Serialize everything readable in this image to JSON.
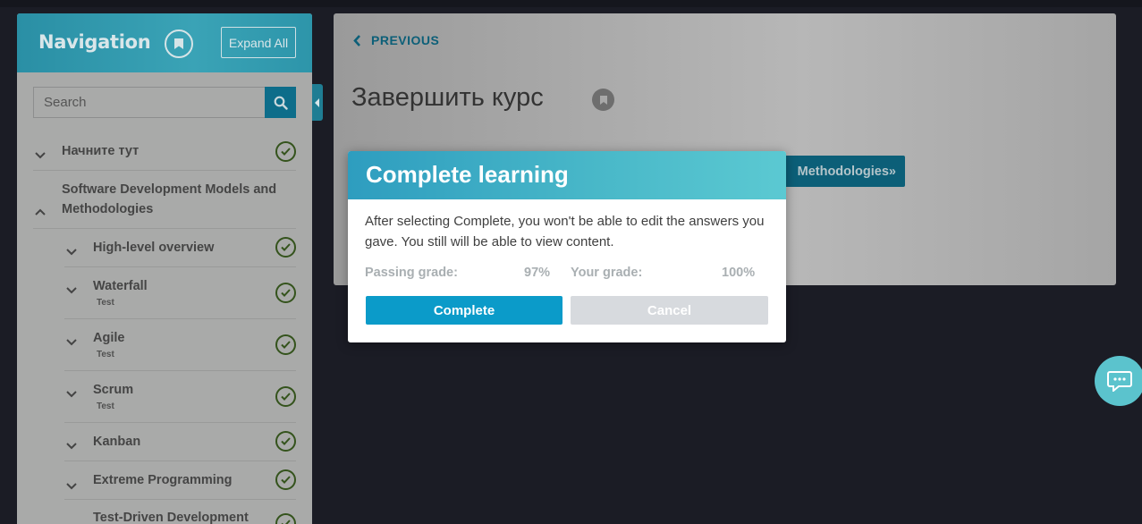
{
  "sidebar": {
    "title": "Navigation",
    "expand_all_label": "Expand All",
    "search_placeholder": "Search",
    "items": [
      {
        "label": "Начните тут",
        "sub": "",
        "level": 0,
        "expanded": false,
        "completed": true
      },
      {
        "label_line1": "Software Development Models and",
        "label_line2": "Methodologies",
        "level": 0,
        "expanded": true,
        "completed": false
      },
      {
        "label": "High-level overview",
        "sub": "",
        "level": 1,
        "expanded": false,
        "completed": true
      },
      {
        "label": "Waterfall",
        "sub": "Test",
        "level": 1,
        "expanded": false,
        "completed": true
      },
      {
        "label": "Agile",
        "sub": "Test",
        "level": 1,
        "expanded": false,
        "completed": true
      },
      {
        "label": "Scrum",
        "sub": "Test",
        "level": 1,
        "expanded": false,
        "completed": true
      },
      {
        "label": "Kanban",
        "sub": "",
        "level": 1,
        "expanded": false,
        "completed": true
      },
      {
        "label": "Extreme Programming",
        "sub": "",
        "level": 1,
        "expanded": false,
        "completed": true
      },
      {
        "label": "Test-Driven Development",
        "sub": "",
        "level": 1,
        "expanded": false,
        "completed": true
      }
    ]
  },
  "main": {
    "previous_label": "PREVIOUS",
    "page_title": "Завершить курс",
    "obscured_button_label": "Methodologies»"
  },
  "modal": {
    "title": "Complete learning",
    "message": "After selecting Complete, you won't be able to edit the answers you gave. You still will be able to view content.",
    "passing_grade_label": "Passing grade:",
    "passing_grade_value": "97%",
    "your_grade_label": "Your grade:",
    "your_grade_value": "100%",
    "complete_label": "Complete",
    "cancel_label": "Cancel"
  },
  "icons": {
    "search": "search-icon",
    "bookmark": "bookmark-icon",
    "chevron_left": "chevron-left-icon",
    "chevron_down": "chevron-down-icon",
    "chevron_up": "chevron-up-icon",
    "check_circle": "check-circle-icon",
    "chat": "chat-icon"
  },
  "colors": {
    "accent": "#0b9bc9",
    "header_gradient_start": "#2e9dbf",
    "header_gradient_end": "#5bc9d2",
    "check": "#34531c",
    "cancel_disabled": "#d7dade"
  }
}
